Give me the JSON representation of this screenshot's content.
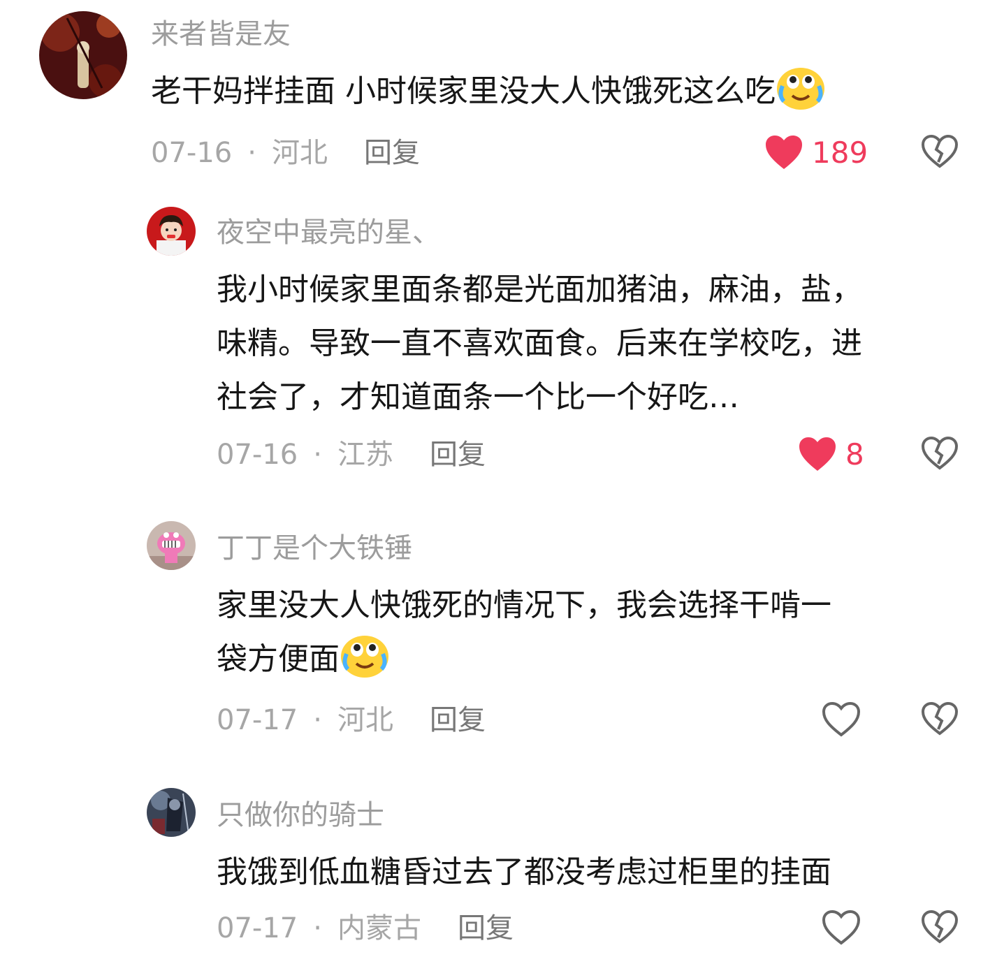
{
  "comments": [
    {
      "user": "来者皆是友",
      "text": "老干妈拌挂面 小时候家里没大人快饿死这么吃",
      "date": "07-16",
      "region": "河北",
      "reply": "回复",
      "likes": "189",
      "liked": true
    },
    {
      "user": "夜空中最亮的星、",
      "text_lines": [
        "我小时候家里面条都是光面加猪油，麻油，盐，",
        "味精。导致一直不喜欢面食。后来在学校吃，进",
        "社会了，才知道面条一个比一个好吃…"
      ],
      "date": "07-16",
      "region": "江苏",
      "reply": "回复",
      "likes": "8",
      "liked": true
    },
    {
      "user": "丁丁是个大铁锤",
      "text_lines": [
        "家里没大人快饿死的情况下，我会选择干啃一",
        "袋方便面"
      ],
      "date": "07-17",
      "region": "河北",
      "reply": "回复",
      "liked": false
    },
    {
      "user": "只做你的骑士",
      "text": "我饿到低血糖昏过去了都没考虑过柜里的挂面",
      "date": "07-17",
      "region": "内蒙古",
      "reply": "回复",
      "liked": false
    }
  ],
  "separator": "·",
  "colors": {
    "like_red": "#ef3b5c",
    "meta_gray": "#a6a6a6",
    "name_gray": "#9c9c9c"
  },
  "icons": {
    "like": "heart-icon",
    "dislike": "broken-heart-icon",
    "emoji": "tears-of-joy-emoji"
  }
}
